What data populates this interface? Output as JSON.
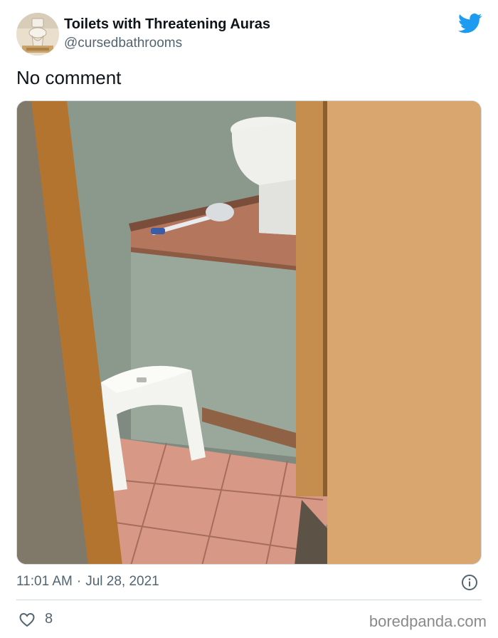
{
  "tweet": {
    "display_name": "Toilets with Threatening Auras",
    "handle": "@cursedbathrooms",
    "text": "No comment",
    "time": "11:01 AM",
    "separator": "·",
    "date": "Jul 28, 2021",
    "like_count": "8"
  },
  "icons": {
    "brand": "twitter-bird-icon",
    "info": "info-icon",
    "like": "heart-icon"
  },
  "colors": {
    "twitter_blue": "#1d9bf0",
    "secondary_text": "#536471",
    "divider": "#cfd9de"
  },
  "watermark": "boredpanda.com"
}
